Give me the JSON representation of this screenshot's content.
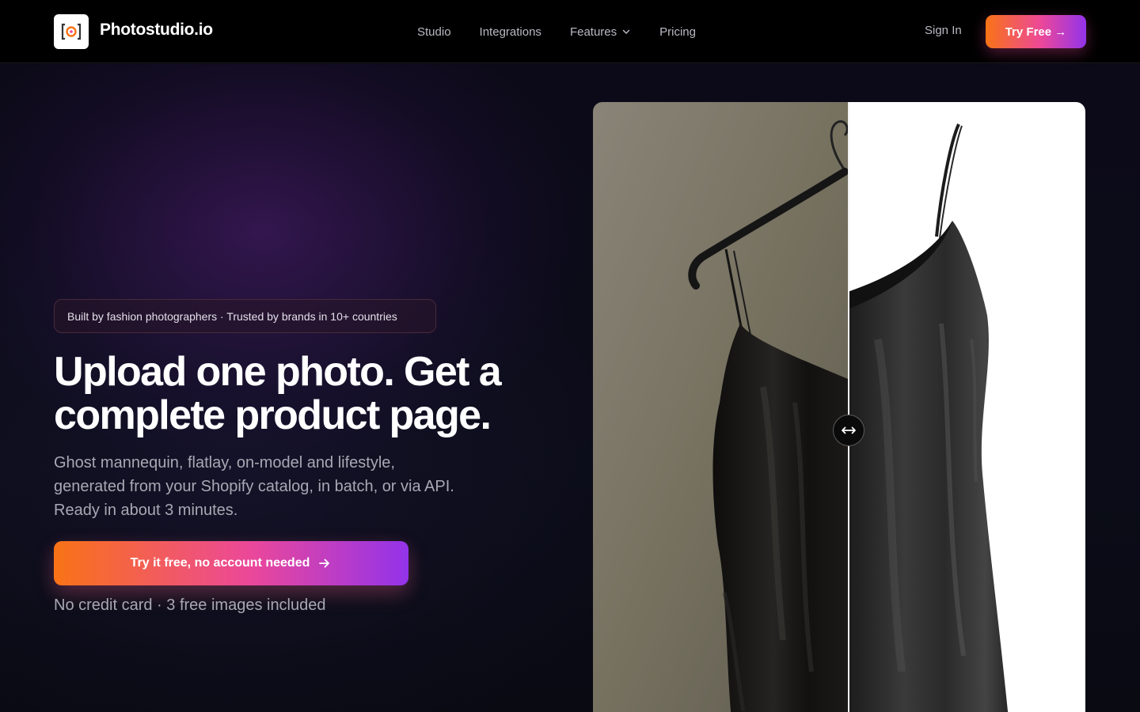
{
  "brand": {
    "name": "Photostudio.io",
    "logo_icon": "camera-bracket-icon",
    "accent_orange": "#f97316",
    "accent_pink": "#ec4899",
    "accent_purple": "#9333ea"
  },
  "nav": {
    "links": [
      {
        "label": "Studio"
      },
      {
        "label": "Integrations"
      },
      {
        "label": "Features",
        "icon": "chevron-down-icon"
      },
      {
        "label": "Pricing"
      }
    ],
    "sign_in": "Sign In",
    "try_free": "Try Free →"
  },
  "hero": {
    "badge": "Built by fashion photographers · Trusted by brands in 10+ countries",
    "headline_line1": "Upload one photo. Get a",
    "headline_line2": "complete product page.",
    "sub_line1": "Ghost mannequin, flatlay, on-model and lifestyle,",
    "sub_line2": "generated from your Shopify catalog, in batch, or via API.",
    "sub_line3": "Ready in about 3 minutes.",
    "cta": "Try it free, no account needed",
    "cta_icon": "arrow-right-icon",
    "note": "No credit card · 3 free images included"
  },
  "compare": {
    "before_label": "original-photo",
    "after_label": "ghost-mannequin-result",
    "handle_icon": "left-right-arrow-icon"
  }
}
